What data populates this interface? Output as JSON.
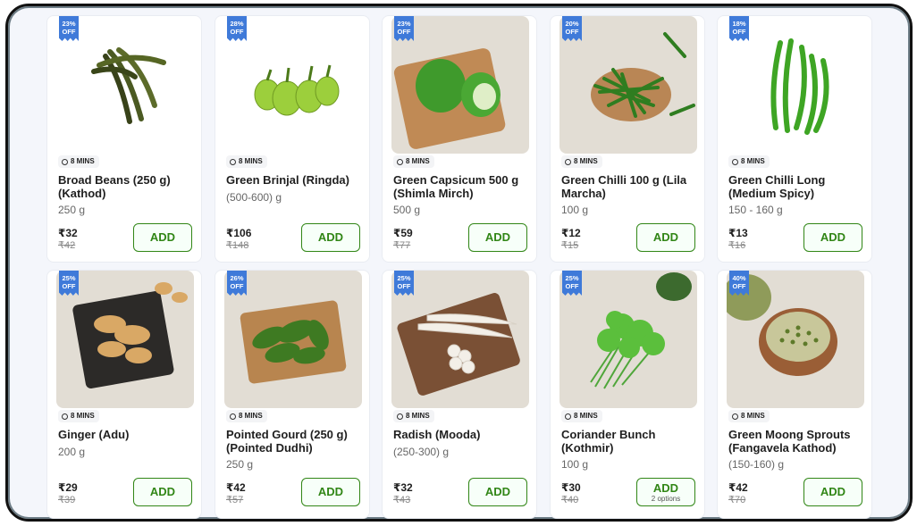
{
  "products": [
    {
      "discount": "23%",
      "off": "OFF",
      "eta": "8 MINS",
      "name": "Broad Beans (250 g) (Kathod)",
      "weight": "250 g",
      "price": "₹32",
      "mrp": "₹42",
      "add": "ADD",
      "icon": "broad-beans-icon"
    },
    {
      "discount": "28%",
      "off": "OFF",
      "eta": "8 MINS",
      "name": "Green Brinjal (Ringda)",
      "weight": "(500-600) g",
      "price": "₹106",
      "mrp": "₹148",
      "add": "ADD",
      "icon": "green-brinjal-icon"
    },
    {
      "discount": "23%",
      "off": "OFF",
      "eta": "8 MINS",
      "name": "Green Capsicum 500 g (Shimla Mirch)",
      "weight": "500 g",
      "price": "₹59",
      "mrp": "₹77",
      "add": "ADD",
      "icon": "green-capsicum-icon"
    },
    {
      "discount": "20%",
      "off": "OFF",
      "eta": "8 MINS",
      "name": "Green Chilli 100 g (Lila Marcha)",
      "weight": "100 g",
      "price": "₹12",
      "mrp": "₹15",
      "add": "ADD",
      "icon": "green-chilli-icon"
    },
    {
      "discount": "18%",
      "off": "OFF",
      "eta": "8 MINS",
      "name": "Green Chilli Long (Medium Spicy)",
      "weight": "150 - 160 g",
      "price": "₹13",
      "mrp": "₹16",
      "add": "ADD",
      "icon": "green-chilli-long-icon"
    },
    {
      "discount": "25%",
      "off": "OFF",
      "eta": "8 MINS",
      "name": "Ginger (Adu)",
      "weight": "200 g",
      "price": "₹29",
      "mrp": "₹39",
      "add": "ADD",
      "icon": "ginger-icon"
    },
    {
      "discount": "26%",
      "off": "OFF",
      "eta": "8 MINS",
      "name": "Pointed Gourd (250 g) (Pointed Dudhi)",
      "weight": "250 g",
      "price": "₹42",
      "mrp": "₹57",
      "add": "ADD",
      "icon": "pointed-gourd-icon"
    },
    {
      "discount": "25%",
      "off": "OFF",
      "eta": "8 MINS",
      "name": "Radish (Mooda)",
      "weight": "(250-300) g",
      "price": "₹32",
      "mrp": "₹43",
      "add": "ADD",
      "icon": "radish-icon"
    },
    {
      "discount": "25%",
      "off": "OFF",
      "eta": "8 MINS",
      "name": "Coriander Bunch (Kothmir)",
      "weight": "100 g",
      "price": "₹30",
      "mrp": "₹40",
      "add": "ADD",
      "add_sub": "2 options",
      "icon": "coriander-icon"
    },
    {
      "discount": "40%",
      "off": "OFF",
      "eta": "8 MINS",
      "name": "Green Moong Sprouts (Fangavela Kathod)",
      "weight": "(150-160) g",
      "price": "₹42",
      "mrp": "₹70",
      "add": "ADD",
      "icon": "moong-sprouts-icon"
    }
  ],
  "colors": {
    "accent_green": "#318616",
    "badge_blue": "#3f7ad9"
  }
}
